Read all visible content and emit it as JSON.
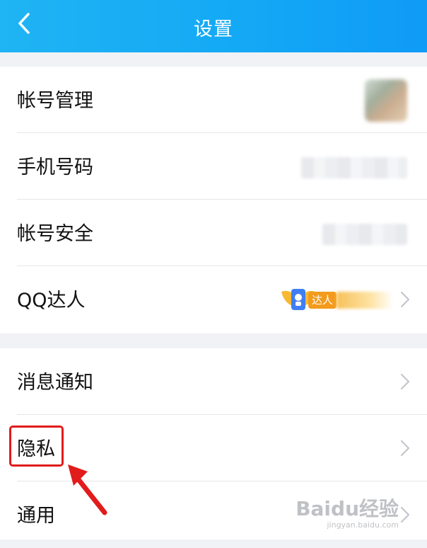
{
  "header": {
    "title": "设置",
    "back_icon": "chevron-left-icon"
  },
  "group1": {
    "rows": [
      {
        "label": "帐号管理"
      },
      {
        "label": "手机号码"
      },
      {
        "label": "帐号安全"
      },
      {
        "label": "QQ达人",
        "badge_text": "达人"
      }
    ]
  },
  "group2": {
    "rows": [
      {
        "label": "消息通知"
      },
      {
        "label": "隐私"
      },
      {
        "label": "通用"
      }
    ]
  },
  "watermark": {
    "logo": "Baidu经验",
    "sub": "jingyan.baidu.com"
  },
  "colors": {
    "header": "#14a9f5",
    "highlight": "#e21b1b"
  }
}
